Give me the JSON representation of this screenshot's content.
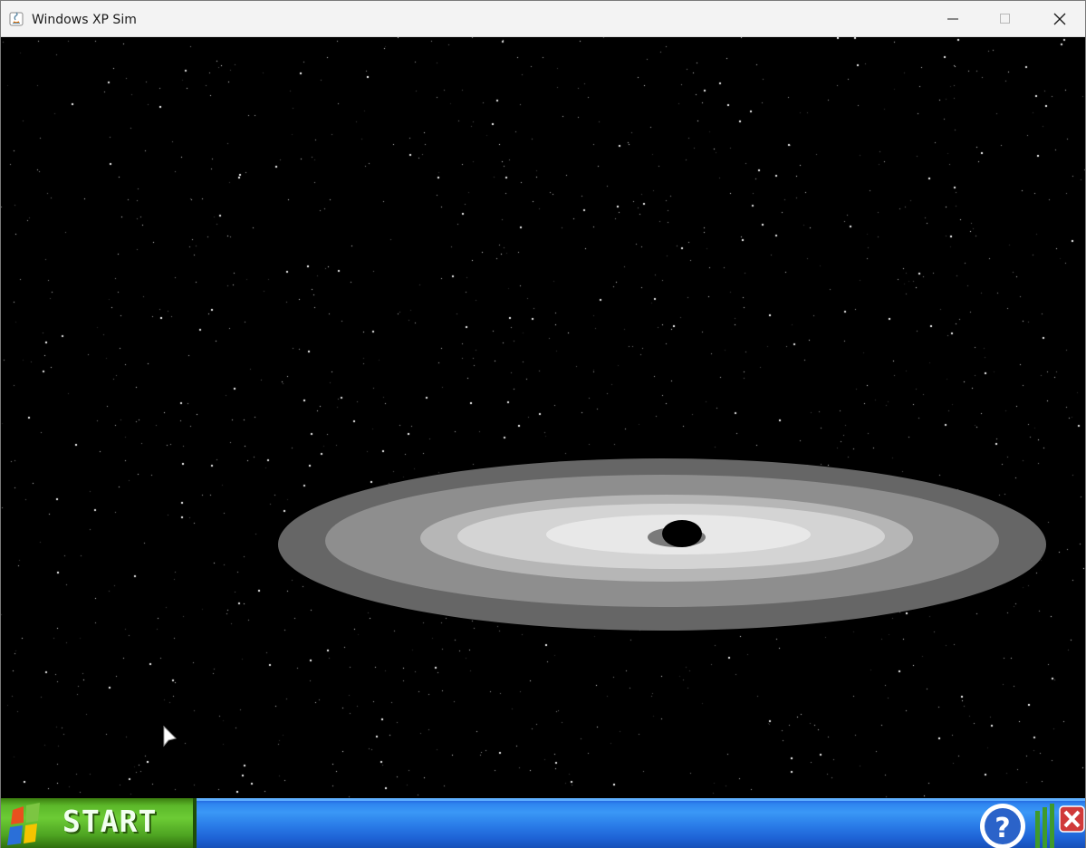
{
  "window": {
    "title": "Windows XP Sim",
    "controls": {
      "minimize": "minimize",
      "maximize": "maximize",
      "close": "close"
    }
  },
  "scene": {
    "background": "#000000",
    "star_color": "#ffffff",
    "disc_colors": [
      "#666666",
      "#8e8e8e",
      "#b6b6b6",
      "#d4d4d4",
      "#e8e8e8"
    ],
    "core_color": "#000000"
  },
  "taskbar": {
    "start_label": "START",
    "colors": {
      "bar": "#2a7ce8",
      "start": "#5cb82a",
      "close": "#d03a3a"
    },
    "tray": {
      "help_icon": "help-icon",
      "signal_icon": "signal-bars-icon",
      "close_icon": "close-icon"
    }
  }
}
